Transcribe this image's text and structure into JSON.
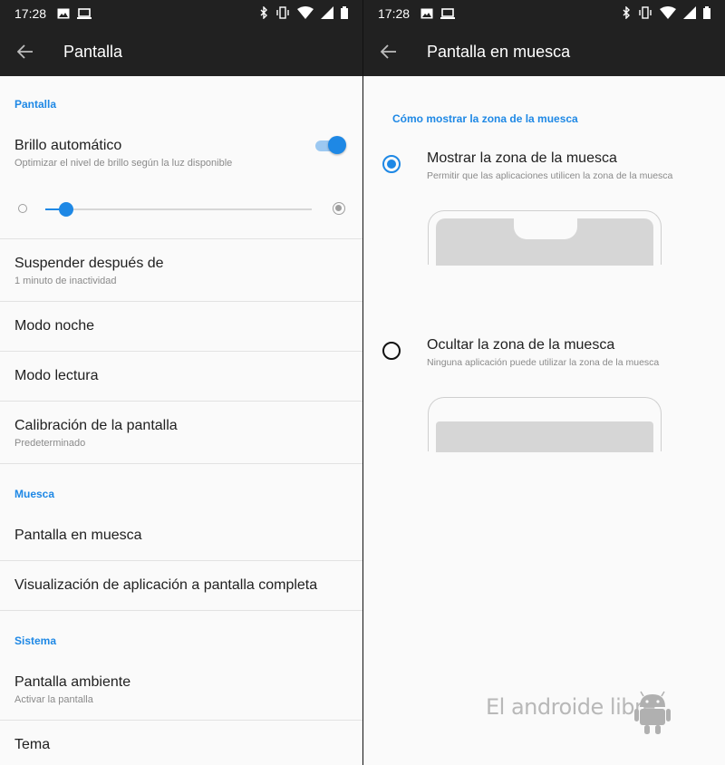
{
  "status": {
    "time": "17:28"
  },
  "left": {
    "title": "Pantalla",
    "section_pantalla": "Pantalla",
    "brillo_label": "Brillo automático",
    "brillo_sub": "Optimizar el nivel de brillo según la luz disponible",
    "brillo_enabled": true,
    "brightness_level": 0.04,
    "suspender_label": "Suspender después de",
    "suspender_sub": "1 minuto de inactividad",
    "modo_noche": "Modo noche",
    "modo_lectura": "Modo lectura",
    "calibracion_label": "Calibración de la pantalla",
    "calibracion_sub": "Predeterminado",
    "section_muesca": "Muesca",
    "pantalla_muesca": "Pantalla en muesca",
    "visualizacion": "Visualización de aplicación a pantalla completa",
    "section_sistema": "Sistema",
    "ambiente_label": "Pantalla ambiente",
    "ambiente_sub": "Activar la pantalla",
    "tema": "Tema"
  },
  "right": {
    "title": "Pantalla en muesca",
    "section": "Cómo mostrar la zona de la muesca",
    "options": [
      {
        "label": "Mostrar la zona de la muesca",
        "sub": "Permitir que las aplicaciones utilicen la zona de la muesca",
        "selected": true
      },
      {
        "label": "Ocultar la zona de la muesca",
        "sub": "Ninguna aplicación puede utilizar la zona de la muesca",
        "selected": false
      }
    ]
  },
  "watermark": "El androide libre",
  "colors": {
    "accent": "#1e88e5",
    "bar": "#212121"
  }
}
